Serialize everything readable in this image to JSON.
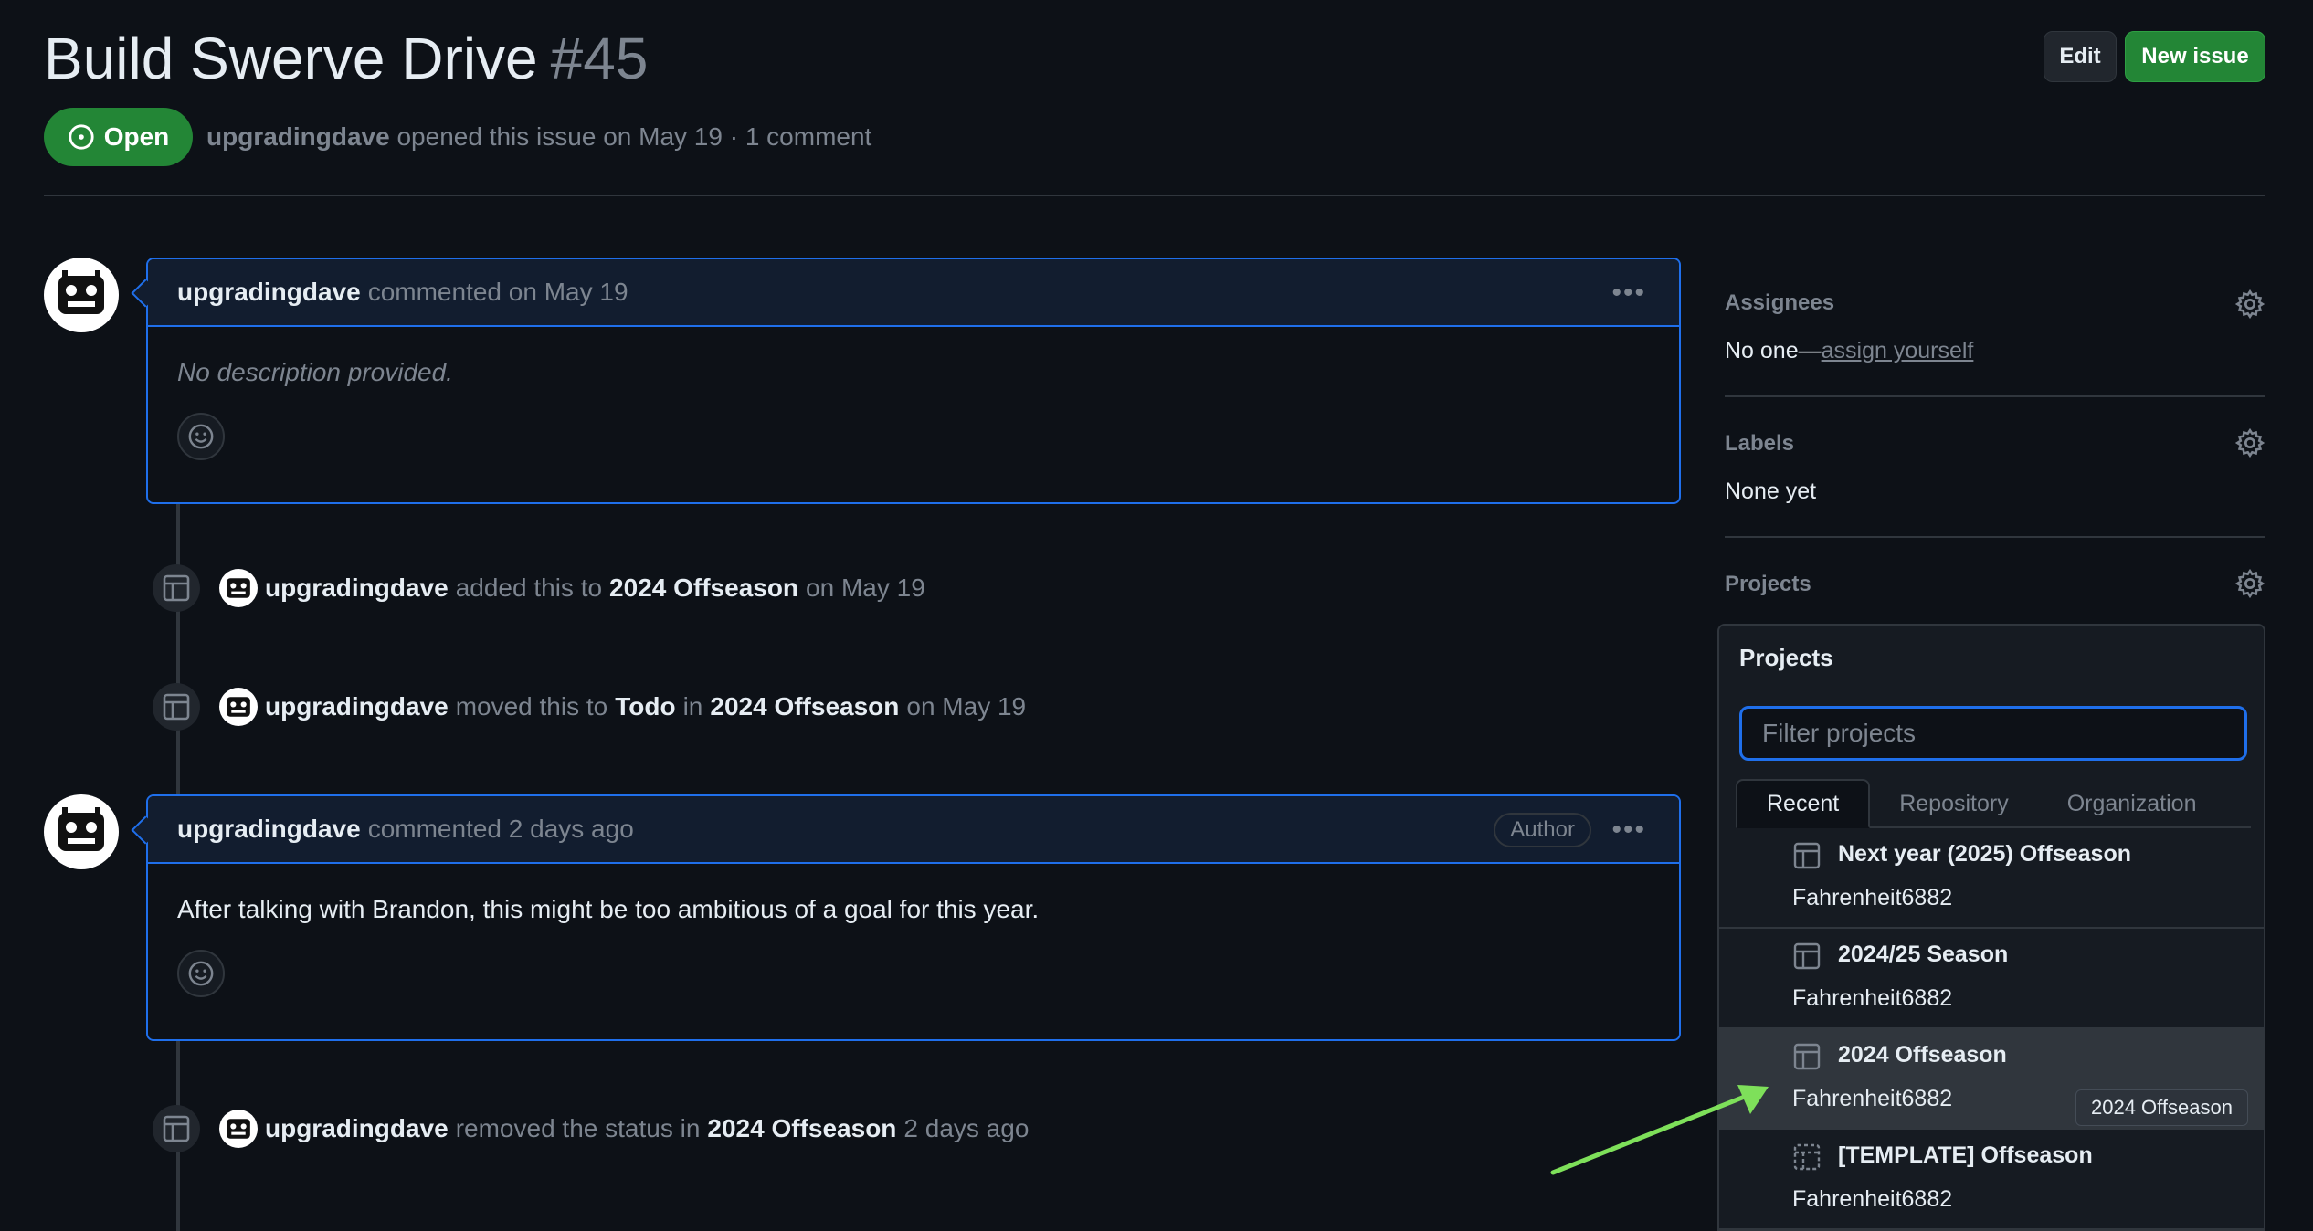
{
  "issue": {
    "title": "Build Swerve Drive",
    "number": "#45",
    "state": "Open",
    "author": "upgradingdave",
    "meta_suffix": "opened this issue on May 19 · 1 comment"
  },
  "header_buttons": {
    "edit": "Edit",
    "new_issue": "New issue"
  },
  "comments": [
    {
      "author": "upgradingdave",
      "when": "commented on May 19",
      "body": "No description provided.",
      "badge": ""
    },
    {
      "author": "upgradingdave",
      "when": "commented 2 days ago",
      "body": "After talking with Brandon, this might be too ambitious of a goal for this year.",
      "badge": "Author"
    }
  ],
  "events": [
    {
      "actor": "upgradingdave",
      "t1": "added this to",
      "project": "2024 Offseason",
      "t2": "on May 19"
    },
    {
      "actor": "upgradingdave",
      "t1": "moved this to",
      "status": "Todo",
      "t_in": "in",
      "project": "2024 Offseason",
      "t2": "on May 19"
    },
    {
      "actor": "upgradingdave",
      "t1": "removed the status in",
      "project": "2024 Offseason",
      "t2": "2 days ago"
    }
  ],
  "sidebar": {
    "assignees": {
      "heading": "Assignees",
      "prefix": "No one—",
      "link": "assign yourself"
    },
    "labels": {
      "heading": "Labels",
      "value": "None yet"
    },
    "projects": {
      "heading": "Projects"
    }
  },
  "projects_dropdown": {
    "title": "Projects",
    "filter_placeholder": "Filter projects",
    "tabs": [
      "Recent",
      "Repository",
      "Organization"
    ],
    "items": [
      {
        "name": "Next year (2025) Offseason",
        "owner": "Fahrenheit6882",
        "icon": "table-icon"
      },
      {
        "name": "2024/25 Season",
        "owner": "Fahrenheit6882",
        "icon": "table-icon"
      },
      {
        "name": "2024 Offseason",
        "owner": "Fahrenheit6882",
        "icon": "table-icon"
      },
      {
        "name": "[TEMPLATE] Offseason",
        "owner": "Fahrenheit6882",
        "icon": "template-icon"
      }
    ],
    "tooltip": "2024 Offseason"
  },
  "colors": {
    "background": "#0d1117",
    "accent_blue": "#1f6feb",
    "open_green": "#238636",
    "annotation_arrow": "#7ee05a"
  }
}
